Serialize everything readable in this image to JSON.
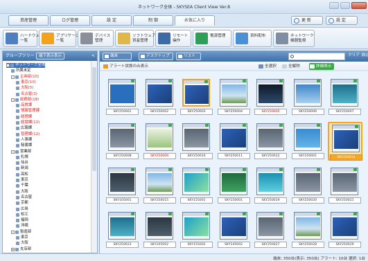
{
  "window": {
    "title": "ネットワーク全体 - SKYSEA Client View Ver.8"
  },
  "menu_tabs": [
    {
      "label": "資産管理"
    },
    {
      "label": "ログ管理"
    },
    {
      "label": "設 定"
    },
    {
      "label": "制 御"
    },
    {
      "label": "お気に入り"
    }
  ],
  "menu_right": {
    "refresh_label": "更 新",
    "settings_label": "設 定"
  },
  "toolbar": [
    {
      "label": "ハードウェア\n一覧",
      "color": "#4f7fc0"
    },
    {
      "label": "アプリケーション\n一覧",
      "color": "#f2a31b"
    },
    {
      "label": "デバイス\n管理",
      "color": "#8a8f9a"
    },
    {
      "label": "ソフトウェア\n資産管理",
      "color": "#e0b84a"
    },
    {
      "label": "リモート\n操作",
      "color": "#3e6aa8"
    },
    {
      "label": "電源管理",
      "color": "#2f9e58"
    },
    {
      "label": "資料配布",
      "color": "#4b8fd6"
    },
    {
      "label": "ネットワーク\n機器監視",
      "color": "#7f8ea3"
    }
  ],
  "left_panel": {
    "header": "グループツリー",
    "show_button": "端下表示表示",
    "collapse": "<",
    "tree": [
      {
        "label": "ネットワーク全体",
        "depth": 0,
        "selected": true,
        "expander": "-"
      },
      {
        "label": "所属未定",
        "depth": 1
      },
      {
        "label": "企画部(10)",
        "depth": 1,
        "red": true,
        "expander": "-"
      },
      {
        "label": "東京(10)",
        "depth": 2,
        "red": true
      },
      {
        "label": "大阪(5)",
        "depth": 2,
        "red": true
      },
      {
        "label": "名古屋(3)",
        "depth": 2,
        "red": true
      },
      {
        "label": "総務部(18)",
        "depth": 1,
        "red": true,
        "expander": "-"
      },
      {
        "label": "品質課",
        "depth": 2,
        "red": true
      },
      {
        "label": "情報管理課",
        "depth": 2,
        "red": true
      },
      {
        "label": "経理課",
        "depth": 2,
        "red": true
      },
      {
        "label": "経営課(12)",
        "depth": 2,
        "red": true
      },
      {
        "label": "広報課",
        "depth": 2
      },
      {
        "label": "管理課(12)",
        "depth": 2,
        "red": true
      },
      {
        "label": "人事課",
        "depth": 2
      },
      {
        "label": "秘書課",
        "depth": 2
      },
      {
        "label": "営業部",
        "depth": 1,
        "expander": "-"
      },
      {
        "label": "札幌",
        "depth": 2
      },
      {
        "label": "仙台",
        "depth": 2
      },
      {
        "label": "新潟",
        "depth": 2
      },
      {
        "label": "高松",
        "depth": 2
      },
      {
        "label": "東京",
        "depth": 2
      },
      {
        "label": "千葉",
        "depth": 2
      },
      {
        "label": "大阪",
        "depth": 2
      },
      {
        "label": "名古屋",
        "depth": 2
      },
      {
        "label": "京都",
        "depth": 2
      },
      {
        "label": "広島",
        "depth": 2
      },
      {
        "label": "松江",
        "depth": 2
      },
      {
        "label": "福岡",
        "depth": 2
      },
      {
        "label": "沖縄",
        "depth": 2
      },
      {
        "label": "製造部",
        "depth": 1,
        "expander": "-"
      },
      {
        "label": "東京",
        "depth": 2
      },
      {
        "label": "大阪",
        "depth": 2
      },
      {
        "label": "支店部",
        "depth": 1,
        "expander": "+"
      }
    ]
  },
  "right_panel": {
    "view_buttons": [
      {
        "label": "端末"
      },
      {
        "label": "デスクトップ"
      },
      {
        "label": "リスト"
      }
    ],
    "search_placeholder": "",
    "clear_label": "クリア",
    "next_label": "絞込",
    "alert_toggle": "アラート状態のみ表示",
    "select_all": "全選択",
    "deselect_all": "全解除",
    "detail_button": "詳細表示"
  },
  "tiles": [
    {
      "label": "SKY250001",
      "kind": "mycomputer"
    },
    {
      "label": "SKY250002",
      "kind": "desktop"
    },
    {
      "label": "SKY250003",
      "kind": "desktop",
      "highlight": true
    },
    {
      "label": "SKY250004",
      "kind": "landscape"
    },
    {
      "label": "SKY250005",
      "kind": "dark",
      "alert": true
    },
    {
      "label": "SKY250006",
      "kind": "folder"
    },
    {
      "label": "SKY250007",
      "kind": "teal"
    },
    {
      "label": "SKY250008",
      "kind": "gray"
    },
    {
      "label": "SKY250009",
      "kind": "green",
      "alert": true
    },
    {
      "label": "SKY250010",
      "kind": "gray"
    },
    {
      "label": "SKY250011",
      "kind": "desktop"
    },
    {
      "label": "SKY250012",
      "kind": "gray"
    },
    {
      "label": "SKY150001",
      "kind": "blue"
    },
    {
      "label": "SKY250014",
      "kind": "desktop",
      "selected": true
    },
    {
      "label": "SKY105001",
      "kind": "android"
    },
    {
      "label": "SKY250015",
      "kind": "landscape"
    },
    {
      "label": "SKY155001",
      "kind": "gradient"
    },
    {
      "label": "SKY150001",
      "kind": "network"
    },
    {
      "label": "SKY250019",
      "kind": "cyan"
    },
    {
      "label": "SKY250020",
      "kind": "gray"
    },
    {
      "label": "SKY250021",
      "kind": "gray"
    },
    {
      "label": "SKY250023",
      "kind": "teal"
    },
    {
      "label": "SKY105002",
      "kind": "android"
    },
    {
      "label": "SKY155002",
      "kind": "gradient"
    },
    {
      "label": "SKY145002",
      "kind": "desktop"
    },
    {
      "label": "SKY250027",
      "kind": "gray"
    },
    {
      "label": "SKY250028",
      "kind": "landscape"
    },
    {
      "label": "SKY250029",
      "kind": "desktop"
    }
  ],
  "status": {
    "text": "端末: 350台(表示: 350台)  アラート: 10台  選択: 1台"
  }
}
